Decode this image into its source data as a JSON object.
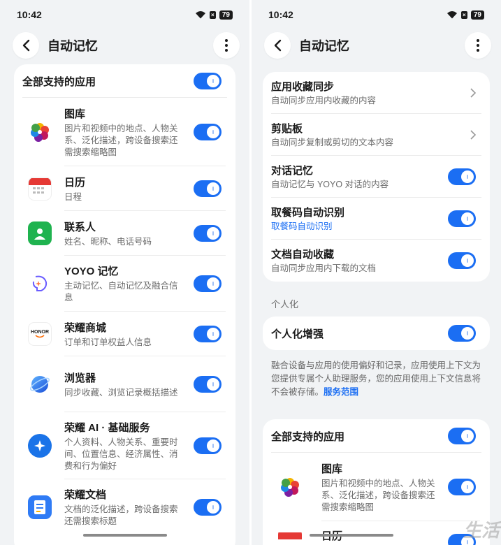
{
  "status": {
    "time": "10:42",
    "battery": "79"
  },
  "page": {
    "title": "自动记忆"
  },
  "left": {
    "all_apps_label": "全部支持的应用",
    "apps": [
      {
        "name": "图库",
        "desc": "图片和视频中的地点、人物关系、泛化描述，跨设备搜索还需搜索缩略图",
        "icon": "gallery-icon"
      },
      {
        "name": "日历",
        "desc": "日程",
        "icon": "calendar-icon"
      },
      {
        "name": "联系人",
        "desc": "姓名、昵称、电话号码",
        "icon": "contacts-icon"
      },
      {
        "name": "YOYO 记忆",
        "desc": "主动记忆、自动记忆及融合信息",
        "icon": "yoyo-memory-icon"
      },
      {
        "name": "荣耀商城",
        "desc": "订单和订单权益人信息",
        "icon": "honor-mall-icon",
        "icon_text": "HONOR"
      },
      {
        "name": "浏览器",
        "desc": "同步收藏、浏览记录概括描述",
        "icon": "browser-icon"
      },
      {
        "name": "荣耀 AI · 基础服务",
        "desc": "个人资料、人物关系、重要时间、位置信息、经济属性、消费和行为偏好",
        "icon": "honor-ai-icon"
      },
      {
        "name": "荣耀文档",
        "desc": "文档的泛化描述，跨设备搜索还需搜索标题",
        "icon": "honor-docs-icon"
      }
    ]
  },
  "right": {
    "memory_items": [
      {
        "title": "应用收藏同步",
        "desc": "自动同步应用内收藏的内容",
        "control": "chevron"
      },
      {
        "title": "剪贴板",
        "desc": "自动同步复制或剪切的文本内容",
        "control": "chevron"
      },
      {
        "title": "对话记忆",
        "desc": "自动记忆与 YOYO 对话的内容",
        "control": "toggle"
      },
      {
        "title": "取餐码自动识别",
        "desc": "取餐码自动识别",
        "desc_is_link": true,
        "control": "toggle"
      },
      {
        "title": "文档自动收藏",
        "desc": "自动同步应用内下载的文档",
        "control": "toggle"
      }
    ],
    "personalization_section": "个人化",
    "personalization_enhance": "个人化增强",
    "note_text": "融合设备与应用的使用偏好和记录，应用使用上下文为您提供专属个人助理服务，您的应用使用上下文信息将不会被存储。",
    "note_link": "服务范围",
    "all_apps_label": "全部支持的应用",
    "apps": [
      {
        "name": "图库",
        "desc": "图片和视频中的地点、人物关系、泛化描述，跨设备搜索还需搜索缩略图"
      },
      {
        "name": "日历",
        "desc": ""
      }
    ]
  },
  "colors": {
    "accent": "#1b6ef3",
    "background": "#f1f3f5"
  },
  "watermark": "生活"
}
